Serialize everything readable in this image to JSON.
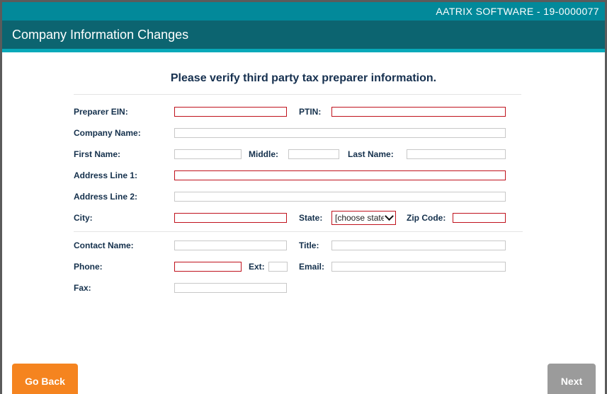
{
  "header": {
    "vendor": "AATRIX SOFTWARE - 19-0000077",
    "title": "Company Information Changes"
  },
  "form": {
    "heading": "Please verify third party tax preparer information.",
    "labels": {
      "preparer_ein": "Preparer EIN:",
      "ptin": "PTIN:",
      "company_name": "Company Name:",
      "first_name": "First Name:",
      "middle": "Middle:",
      "last_name": "Last Name:",
      "address_line_1": "Address Line 1:",
      "address_line_2": "Address Line 2:",
      "city": "City:",
      "state": "State:",
      "zip_code": "Zip Code:",
      "contact_name": "Contact Name:",
      "title": "Title:",
      "phone": "Phone:",
      "ext": "Ext:",
      "email": "Email:",
      "fax": "Fax:"
    },
    "values": {
      "preparer_ein": "",
      "ptin": "",
      "company_name": "",
      "first_name": "",
      "middle": "",
      "last_name": "",
      "address_line_1": "",
      "address_line_2": "",
      "city": "",
      "zip_code": "",
      "contact_name": "",
      "title": "",
      "phone": "",
      "ext": "",
      "email": "",
      "fax": ""
    },
    "state_selected": "[choose state]"
  },
  "footer": {
    "back_label": "Go Back",
    "next_label": "Next"
  },
  "colors": {
    "top_bar": "#02899a",
    "title_bar": "#0c6470",
    "accent_strip": "#07a9b9",
    "required_border": "#c0121d",
    "back_button": "#f5841f",
    "next_button_disabled": "#9b9b9b"
  }
}
